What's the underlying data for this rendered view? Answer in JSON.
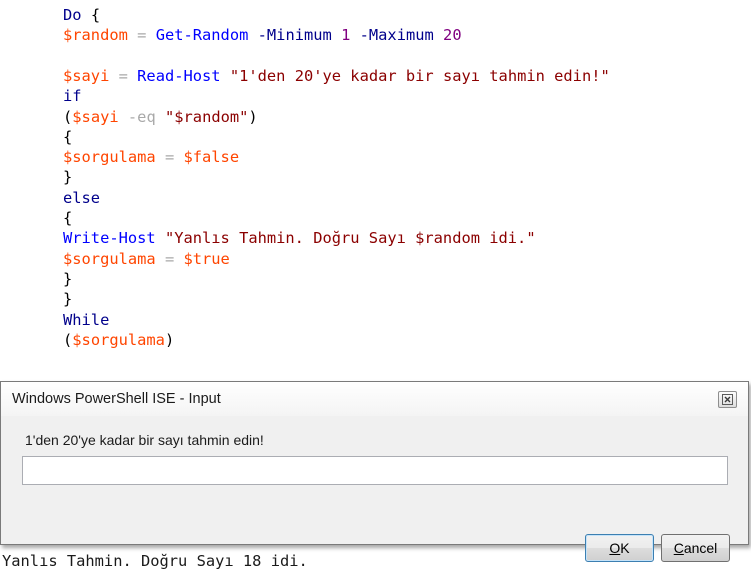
{
  "editor": {
    "lines": [
      [
        {
          "t": "kw",
          "v": "Do"
        },
        {
          "t": "par",
          "v": " {"
        }
      ],
      [
        {
          "t": "var",
          "v": "$random"
        },
        {
          "t": "op",
          "v": " = "
        },
        {
          "t": "cmd",
          "v": "Get-Random"
        },
        {
          "t": "par",
          "v": " "
        },
        {
          "t": "kw",
          "v": "-Minimum"
        },
        {
          "t": "par",
          "v": " "
        },
        {
          "t": "num",
          "v": "1"
        },
        {
          "t": "par",
          "v": " "
        },
        {
          "t": "kw",
          "v": "-Maximum"
        },
        {
          "t": "par",
          "v": " "
        },
        {
          "t": "num",
          "v": "20"
        }
      ],
      [],
      [
        {
          "t": "var",
          "v": "$sayi"
        },
        {
          "t": "op",
          "v": " = "
        },
        {
          "t": "cmd",
          "v": "Read-Host"
        },
        {
          "t": "par",
          "v": " "
        },
        {
          "t": "str",
          "v": "\"1'den 20'ye kadar bir sayı tahmin edin!\""
        }
      ],
      [
        {
          "t": "kw",
          "v": "if"
        }
      ],
      [
        {
          "t": "par",
          "v": "("
        },
        {
          "t": "var",
          "v": "$sayi"
        },
        {
          "t": "par",
          "v": " "
        },
        {
          "t": "op",
          "v": "-eq"
        },
        {
          "t": "par",
          "v": " "
        },
        {
          "t": "str",
          "v": "\"$random\""
        },
        {
          "t": "par",
          "v": ")"
        }
      ],
      [
        {
          "t": "par",
          "v": "{"
        }
      ],
      [
        {
          "t": "var",
          "v": "$sorgulama"
        },
        {
          "t": "op",
          "v": " = "
        },
        {
          "t": "var",
          "v": "$false"
        }
      ],
      [
        {
          "t": "par",
          "v": "}"
        }
      ],
      [
        {
          "t": "kw",
          "v": "else"
        }
      ],
      [
        {
          "t": "par",
          "v": "{"
        }
      ],
      [
        {
          "t": "cmd",
          "v": "Write-Host"
        },
        {
          "t": "par",
          "v": " "
        },
        {
          "t": "str",
          "v": "\"Yanlıs Tahmin. Doğru Sayı $random idi.\""
        }
      ],
      [
        {
          "t": "var",
          "v": "$sorgulama"
        },
        {
          "t": "op",
          "v": " = "
        },
        {
          "t": "var",
          "v": "$true"
        }
      ],
      [
        {
          "t": "par",
          "v": "}"
        }
      ],
      [
        {
          "t": "par",
          "v": "}"
        }
      ],
      [
        {
          "t": "kw",
          "v": "While"
        }
      ],
      [
        {
          "t": "par",
          "v": "("
        },
        {
          "t": "var",
          "v": "$sorgulama"
        },
        {
          "t": "par",
          "v": ")"
        }
      ]
    ]
  },
  "output": {
    "text": "Yanlıs Tahmin. Doğru Sayı 18 idi."
  },
  "dialog": {
    "title": "Windows PowerShell ISE - Input",
    "prompt": "1'den 20'ye kadar bir sayı tahmin edin!",
    "input_value": "",
    "input_placeholder": "",
    "ok_label": "OK",
    "ok_accel": "O",
    "ok_rest": "K",
    "cancel_label": "Cancel",
    "cancel_accel": "C",
    "cancel_rest": "ancel",
    "close_icon": "close-icon"
  },
  "colors": {
    "keyword": "#00008b",
    "variable": "#ff4500",
    "command": "#0000ff",
    "operator": "#a9a9a9",
    "string": "#8b0000",
    "number": "#800080"
  }
}
